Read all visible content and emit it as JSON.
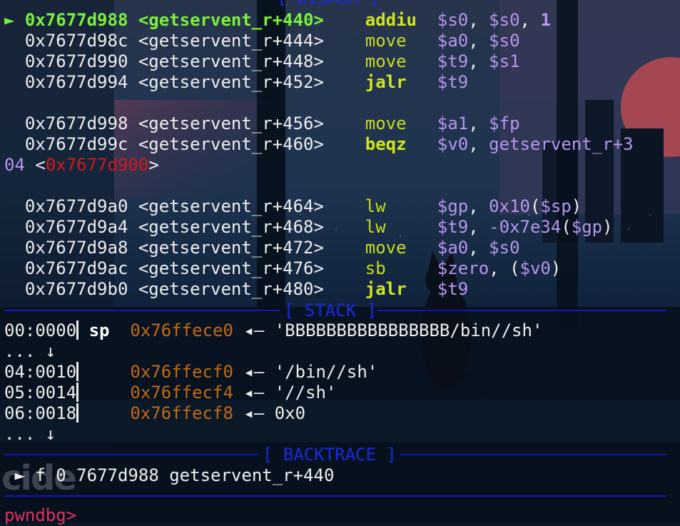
{
  "disasm": {
    "header": "[ DISASM ]",
    "current_marker": "►",
    "rows": [
      {
        "addr": "0x7677d988",
        "sym": "<getservent_r+440>",
        "op": "addiu",
        "args": [
          "$s0",
          ", ",
          "$s0",
          ", ",
          "1"
        ]
      },
      {
        "addr": "0x7677d98c",
        "sym": "<getservent_r+444>",
        "op": "move",
        "args": [
          "$a0",
          ", ",
          "$s0"
        ]
      },
      {
        "addr": "0x7677d990",
        "sym": "<getservent_r+448>",
        "op": "move",
        "args": [
          "$t9",
          ", ",
          "$s1"
        ]
      },
      {
        "addr": "0x7677d994",
        "sym": "<getservent_r+452>",
        "op": "jalr",
        "args": [
          "$t9"
        ]
      },
      {
        "addr": "0x7677d998",
        "sym": "<getservent_r+456>",
        "op": "move",
        "args": [
          "$a1",
          ", ",
          "$fp"
        ]
      },
      {
        "addr": "0x7677d99c",
        "sym": "<getservent_r+460>",
        "op": "beqz",
        "args": [
          "$v0",
          ", ",
          "getservent_r+3"
        ]
      },
      {
        "wrap": [
          "04",
          " <",
          "0x7677d900",
          ">"
        ]
      },
      {
        "addr": "0x7677d9a0",
        "sym": "<getservent_r+464>",
        "op": "lw",
        "args": [
          "$gp",
          ", ",
          "0x10",
          "(",
          "$sp",
          ")"
        ]
      },
      {
        "addr": "0x7677d9a4",
        "sym": "<getservent_r+468>",
        "op": "lw",
        "args": [
          "$t9",
          ", ",
          "-0x7e34",
          "(",
          "$gp",
          ")"
        ]
      },
      {
        "addr": "0x7677d9a8",
        "sym": "<getservent_r+472>",
        "op": "move",
        "args": [
          "$a0",
          ", ",
          "$s0"
        ]
      },
      {
        "addr": "0x7677d9ac",
        "sym": "<getservent_r+476>",
        "op": "sb",
        "args": [
          "$zero",
          ", ",
          "(",
          "$v0",
          ")"
        ]
      },
      {
        "addr": "0x7677d9b0",
        "sym": "<getservent_r+480>",
        "op": "jalr",
        "args": [
          "$t9"
        ]
      }
    ]
  },
  "stack": {
    "header": "[ STACK ]",
    "arrow": "◂—",
    "rows": [
      {
        "off": "00:0000",
        "reg": "sp",
        "addr": "0x76ffece0",
        "val": "'BBBBBBBBBBBBBBBB/bin//sh'"
      },
      {
        "ellipsis": "... ↓"
      },
      {
        "off": "04:0010",
        "reg": "",
        "addr": "0x76ffecf0",
        "val": "'/bin//sh'"
      },
      {
        "off": "05:0014",
        "reg": "",
        "addr": "0x76ffecf4",
        "val": "'//sh'"
      },
      {
        "off": "06:0018",
        "reg": "",
        "addr": "0x76ffecf8",
        "val": "0x0"
      },
      {
        "ellipsis": "... ↓"
      }
    ]
  },
  "backtrace": {
    "header": "[ BACKTRACE ]",
    "marker": "►",
    "frame": "f 0",
    "addr": "7677d988",
    "sym": "getservent_r+440"
  },
  "prompt": "pwndbg>",
  "watermark": "cide",
  "colors": {
    "current": "#7cf03c",
    "opcode": "#c8dc1e",
    "register": "#b696ee",
    "jump_target": "#d41818",
    "stack_addr": "#c06a14",
    "separator": "#1414c8",
    "prompt": "#e03060"
  }
}
